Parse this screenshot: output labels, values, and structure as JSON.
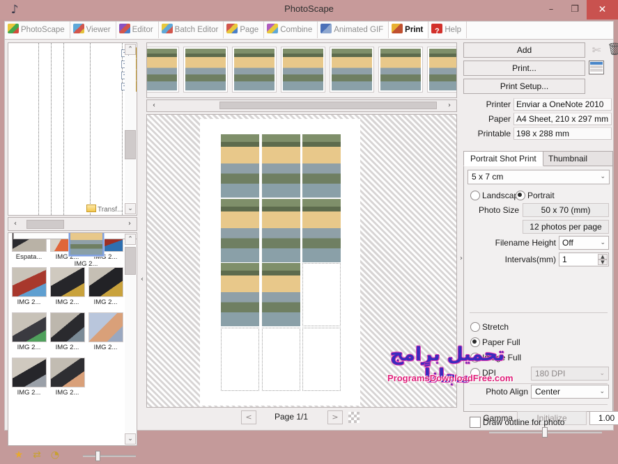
{
  "window": {
    "title": "PhotoScape",
    "app_icon": "photoscape-logo-icon",
    "minimize": "–",
    "maximize": "❐",
    "close": "✕"
  },
  "module_tabs": [
    {
      "label": "PhotoScape",
      "icon": "photoscape-icon",
      "active": false
    },
    {
      "label": "Viewer",
      "icon": "viewer-icon",
      "active": false
    },
    {
      "label": "Editor",
      "icon": "editor-icon",
      "active": false
    },
    {
      "label": "Batch Editor",
      "icon": "batch-editor-icon",
      "active": false
    },
    {
      "label": "Page",
      "icon": "page-icon",
      "active": false
    },
    {
      "label": "Combine",
      "icon": "combine-icon",
      "active": false
    },
    {
      "label": "Animated GIF",
      "icon": "animated-gif-icon",
      "active": false
    },
    {
      "label": "Print",
      "icon": "print-icon",
      "active": true
    },
    {
      "label": "Help",
      "icon": "help-icon",
      "active": false
    }
  ],
  "left_panel": {
    "tree": {
      "nodes": [
        {
          "expander": "+"
        },
        {
          "expander": "+"
        },
        {
          "expander": "+"
        },
        {
          "expander": "−"
        }
      ],
      "partial_label": "Transf...",
      "scroll_up": "⌃",
      "scroll_down": "⌄"
    },
    "hscroll": {
      "left_arrow": "‹",
      "right_arrow": "›"
    },
    "thumbnails": [
      {
        "caption": "Espata...",
        "selected": false
      },
      {
        "caption": "IMG 2...",
        "selected": false
      },
      {
        "caption": "IMG 2...",
        "selected": false
      },
      {
        "caption": "IMG 2...",
        "selected": false
      },
      {
        "caption": "IMG 2...",
        "selected": false
      },
      {
        "caption": "IMG 2...",
        "selected": false
      },
      {
        "caption": "IMG 2...",
        "selected": false
      },
      {
        "caption": "IMG 2...",
        "selected": false
      },
      {
        "caption": "IMG 2...",
        "selected": false
      },
      {
        "caption": "IMG 2...",
        "selected": false
      },
      {
        "caption": "IMG 2...",
        "selected": false
      },
      {
        "caption": "IMG 2...",
        "selected": true
      }
    ],
    "grid_scroll": {
      "up": "⌃",
      "down": "⌄"
    },
    "bottom_tools": [
      {
        "icon": "favorites-star-icon",
        "glyph": "★"
      },
      {
        "icon": "refresh-arrows-icon",
        "glyph": "⇄"
      },
      {
        "icon": "find-photo-icon",
        "glyph": "◔"
      }
    ]
  },
  "filmstrip": {
    "count": 7,
    "scroll_left": "‹",
    "scroll_right": "›"
  },
  "preview": {
    "photo_count": 8,
    "columns": 3,
    "rows": 4,
    "page_label": "Page 1/1",
    "prev_page": "<",
    "next_page": ">"
  },
  "right_panel": {
    "add_label": "Add",
    "print_label": "Print...",
    "print_setup_label": "Print Setup...",
    "cut_icon": "scissors-icon",
    "delete_icon": "trash-bin-icon",
    "list_icon": "list-layout-icon",
    "info": [
      {
        "key": "Printer",
        "value": "Enviar a OneNote 2010"
      },
      {
        "key": "Paper",
        "value": "A4 Sheet, 210 x 297 mm"
      },
      {
        "key": "Printable",
        "value": "198 x 288 mm"
      }
    ],
    "tabs": [
      {
        "label": "Portrait Shot Print",
        "active": true
      },
      {
        "label": "Thumbnail Print",
        "active": false
      }
    ],
    "size_select": {
      "value": "5 x 7 cm",
      "chevron": "⌄"
    },
    "orientation": [
      {
        "label": "Landscape",
        "selected": false
      },
      {
        "label": "Portrait",
        "selected": true
      }
    ],
    "photo_size_label": "Photo Size",
    "photo_size_value": "50 x 70 (mm)",
    "photos_per_page_value": "12 photos per page",
    "filename_height_label": "Filename Height",
    "filename_height_value": "Off",
    "intervals_label": "Intervals(mm)",
    "intervals_value": "1",
    "spinner_up": "▲",
    "spinner_down": "▼",
    "fit_modes": [
      {
        "label": "Stretch",
        "selected": false
      },
      {
        "label": "Paper Full",
        "selected": true
      },
      {
        "label": "Image Full",
        "selected": false
      },
      {
        "label": "DPI",
        "selected": false
      }
    ],
    "dpi_value": "180 DPI",
    "photo_align_label": "Photo Align",
    "photo_align_value": "Center",
    "gamma_label": "Gamma",
    "gamma_init_label": "Initialize",
    "gamma_value": "1.00",
    "draw_outline_label": "Draw outline for photo"
  },
  "watermark": {
    "arabic": "تحميل برامج مجاناً",
    "english": "ProgramsDownloadFree.com"
  },
  "colors": {
    "frame": "#c79a9a",
    "close_button": "#c9524f",
    "panel": "#f0eded",
    "accent_blue": "#4a86c8"
  }
}
